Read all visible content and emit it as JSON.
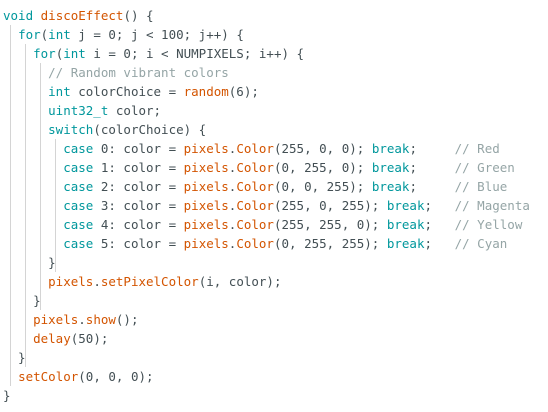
{
  "theme": {
    "background": "#ffffff",
    "text": "#434f54",
    "keyword": "#00979c",
    "function": "#d35400",
    "comment": "#95a5a6",
    "indent_guide": "#d4d4d4"
  },
  "code": {
    "lines": [
      {
        "tokens": [
          {
            "t": "void",
            "c": "kw"
          },
          {
            "t": " ",
            "c": "tx"
          },
          {
            "t": "discoEffect",
            "c": "fn"
          },
          {
            "t": "() {",
            "c": "tx"
          }
        ]
      },
      {
        "tokens": [
          {
            "t": "  ",
            "c": "tx"
          },
          {
            "t": "for",
            "c": "kw"
          },
          {
            "t": "(",
            "c": "tx"
          },
          {
            "t": "int",
            "c": "kw"
          },
          {
            "t": " j = 0; j < 100; j++) {",
            "c": "tx"
          }
        ]
      },
      {
        "tokens": [
          {
            "t": "    ",
            "c": "tx"
          },
          {
            "t": "for",
            "c": "kw"
          },
          {
            "t": "(",
            "c": "tx"
          },
          {
            "t": "int",
            "c": "kw"
          },
          {
            "t": " i = 0; i < NUMPIXELS; i++) {",
            "c": "tx"
          }
        ]
      },
      {
        "tokens": [
          {
            "t": "      ",
            "c": "tx"
          },
          {
            "t": "// Random vibrant colors",
            "c": "cm"
          }
        ]
      },
      {
        "tokens": [
          {
            "t": "      ",
            "c": "tx"
          },
          {
            "t": "int",
            "c": "kw"
          },
          {
            "t": " colorChoice = ",
            "c": "tx"
          },
          {
            "t": "random",
            "c": "fn"
          },
          {
            "t": "(6);",
            "c": "tx"
          }
        ]
      },
      {
        "tokens": [
          {
            "t": "      ",
            "c": "tx"
          },
          {
            "t": "uint32_t",
            "c": "kw"
          },
          {
            "t": " color;",
            "c": "tx"
          }
        ]
      },
      {
        "tokens": [
          {
            "t": "      ",
            "c": "tx"
          },
          {
            "t": "switch",
            "c": "kw"
          },
          {
            "t": "(colorChoice) {",
            "c": "tx"
          }
        ]
      },
      {
        "tokens": [
          {
            "t": "        ",
            "c": "tx"
          },
          {
            "t": "case",
            "c": "kw"
          },
          {
            "t": " 0: color = ",
            "c": "tx"
          },
          {
            "t": "pixels",
            "c": "fn"
          },
          {
            "t": ".",
            "c": "tx"
          },
          {
            "t": "Color",
            "c": "fn"
          },
          {
            "t": "(255, 0, 0); ",
            "c": "tx"
          },
          {
            "t": "break",
            "c": "kw"
          },
          {
            "t": ";     ",
            "c": "tx"
          },
          {
            "t": "// Red",
            "c": "cm"
          }
        ]
      },
      {
        "tokens": [
          {
            "t": "        ",
            "c": "tx"
          },
          {
            "t": "case",
            "c": "kw"
          },
          {
            "t": " 1: color = ",
            "c": "tx"
          },
          {
            "t": "pixels",
            "c": "fn"
          },
          {
            "t": ".",
            "c": "tx"
          },
          {
            "t": "Color",
            "c": "fn"
          },
          {
            "t": "(0, 255, 0); ",
            "c": "tx"
          },
          {
            "t": "break",
            "c": "kw"
          },
          {
            "t": ";     ",
            "c": "tx"
          },
          {
            "t": "// Green",
            "c": "cm"
          }
        ]
      },
      {
        "tokens": [
          {
            "t": "        ",
            "c": "tx"
          },
          {
            "t": "case",
            "c": "kw"
          },
          {
            "t": " 2: color = ",
            "c": "tx"
          },
          {
            "t": "pixels",
            "c": "fn"
          },
          {
            "t": ".",
            "c": "tx"
          },
          {
            "t": "Color",
            "c": "fn"
          },
          {
            "t": "(0, 0, 255); ",
            "c": "tx"
          },
          {
            "t": "break",
            "c": "kw"
          },
          {
            "t": ";     ",
            "c": "tx"
          },
          {
            "t": "// Blue",
            "c": "cm"
          }
        ]
      },
      {
        "tokens": [
          {
            "t": "        ",
            "c": "tx"
          },
          {
            "t": "case",
            "c": "kw"
          },
          {
            "t": " 3: color = ",
            "c": "tx"
          },
          {
            "t": "pixels",
            "c": "fn"
          },
          {
            "t": ".",
            "c": "tx"
          },
          {
            "t": "Color",
            "c": "fn"
          },
          {
            "t": "(255, 0, 255); ",
            "c": "tx"
          },
          {
            "t": "break",
            "c": "kw"
          },
          {
            "t": ";   ",
            "c": "tx"
          },
          {
            "t": "// Magenta",
            "c": "cm"
          }
        ]
      },
      {
        "tokens": [
          {
            "t": "        ",
            "c": "tx"
          },
          {
            "t": "case",
            "c": "kw"
          },
          {
            "t": " 4: color = ",
            "c": "tx"
          },
          {
            "t": "pixels",
            "c": "fn"
          },
          {
            "t": ".",
            "c": "tx"
          },
          {
            "t": "Color",
            "c": "fn"
          },
          {
            "t": "(255, 255, 0); ",
            "c": "tx"
          },
          {
            "t": "break",
            "c": "kw"
          },
          {
            "t": ";   ",
            "c": "tx"
          },
          {
            "t": "// Yellow",
            "c": "cm"
          }
        ]
      },
      {
        "tokens": [
          {
            "t": "        ",
            "c": "tx"
          },
          {
            "t": "case",
            "c": "kw"
          },
          {
            "t": " 5: color = ",
            "c": "tx"
          },
          {
            "t": "pixels",
            "c": "fn"
          },
          {
            "t": ".",
            "c": "tx"
          },
          {
            "t": "Color",
            "c": "fn"
          },
          {
            "t": "(0, 255, 255); ",
            "c": "tx"
          },
          {
            "t": "break",
            "c": "kw"
          },
          {
            "t": ";   ",
            "c": "tx"
          },
          {
            "t": "// Cyan",
            "c": "cm"
          }
        ]
      },
      {
        "tokens": [
          {
            "t": "      }",
            "c": "tx"
          }
        ]
      },
      {
        "tokens": [
          {
            "t": "      ",
            "c": "tx"
          },
          {
            "t": "pixels",
            "c": "fn"
          },
          {
            "t": ".",
            "c": "tx"
          },
          {
            "t": "setPixelColor",
            "c": "fn"
          },
          {
            "t": "(i, color);",
            "c": "tx"
          }
        ]
      },
      {
        "tokens": [
          {
            "t": "    }",
            "c": "tx"
          }
        ]
      },
      {
        "tokens": [
          {
            "t": "    ",
            "c": "tx"
          },
          {
            "t": "pixels",
            "c": "fn"
          },
          {
            "t": ".",
            "c": "tx"
          },
          {
            "t": "show",
            "c": "fn"
          },
          {
            "t": "();",
            "c": "tx"
          }
        ]
      },
      {
        "tokens": [
          {
            "t": "    ",
            "c": "tx"
          },
          {
            "t": "delay",
            "c": "fn"
          },
          {
            "t": "(50);",
            "c": "tx"
          }
        ]
      },
      {
        "tokens": [
          {
            "t": "  }",
            "c": "tx"
          }
        ]
      },
      {
        "tokens": [
          {
            "t": "  ",
            "c": "tx"
          },
          {
            "t": "setColor",
            "c": "fn"
          },
          {
            "t": "(0, 0, 0);",
            "c": "tx"
          }
        ]
      },
      {
        "tokens": [
          {
            "t": "}",
            "c": "tx"
          }
        ]
      }
    ]
  }
}
